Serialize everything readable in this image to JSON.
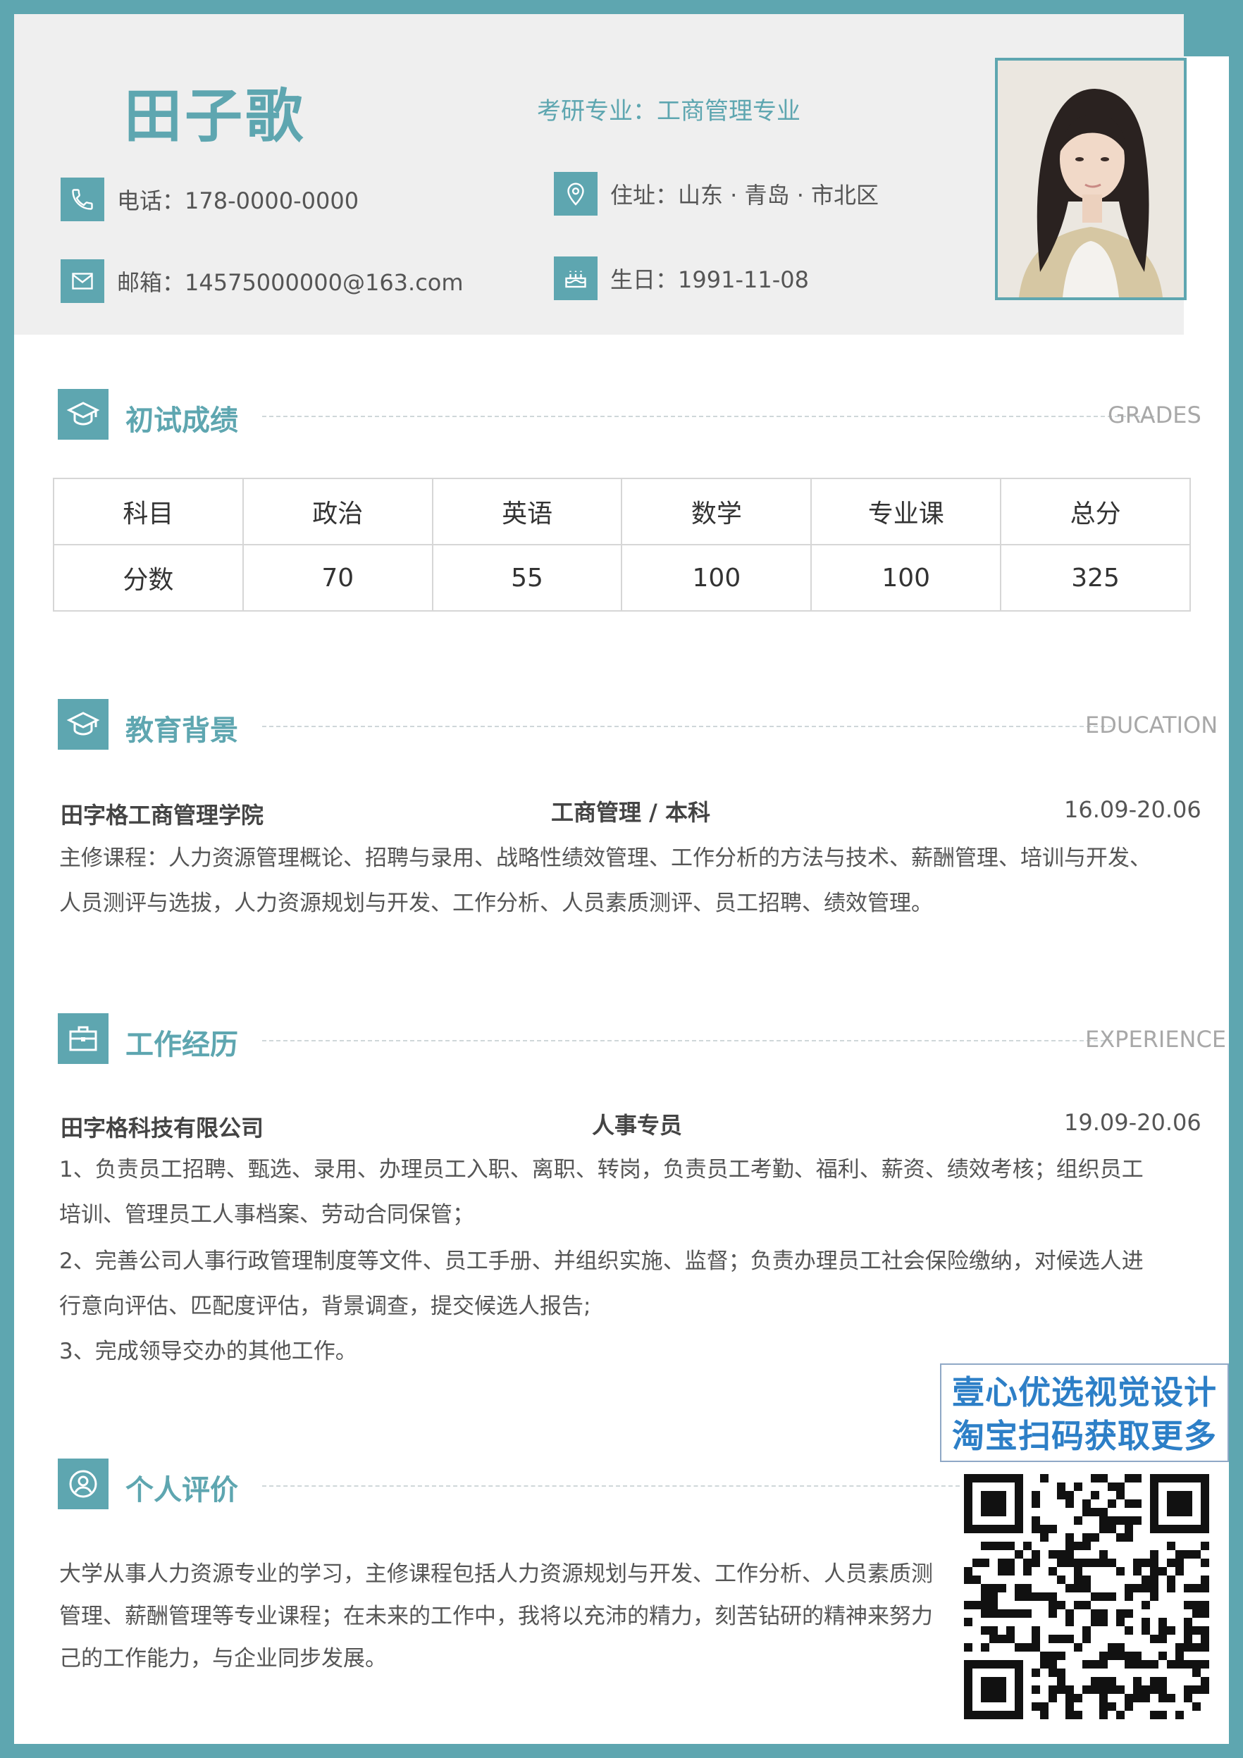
{
  "header": {
    "name": "田子歌",
    "target": "考研专业：工商管理专业",
    "phone": "电话：178-0000-0000",
    "address": "住址：山东 · 青岛 · 市北区",
    "email": "邮箱：14575000000@163.com",
    "birthday": "生日：1991-11-08"
  },
  "grades": {
    "title": "初试成绩",
    "english": "GRADES",
    "headers": [
      "科目",
      "政治",
      "英语",
      "数学",
      "专业课",
      "总分"
    ],
    "scores": [
      "分数",
      "70",
      "55",
      "100",
      "100",
      "325"
    ]
  },
  "education": {
    "title": "教育背景",
    "english": "EDUCATION",
    "school": "田字格工商管理学院",
    "major": "工商管理 / 本科",
    "period": "16.09-20.06",
    "courses_line1": "主修课程：人力资源管理概论、招聘与录用、战略性绩效管理、工作分析的方法与技术、薪酬管理、培训与开发、",
    "courses_line2": "人员测评与选拔，人力资源规划与开发、工作分析、人员素质测评、员工招聘、绩效管理。"
  },
  "experience": {
    "title": "工作经历",
    "english": "EXPERIENCE",
    "company": "田字格科技有限公司",
    "position": "人事专员",
    "period": "19.09-20.06",
    "line1": "1、负责员工招聘、甄选、录用、办理员工入职、离职、转岗，负责员工考勤、福利、薪资、绩效考核；组织员工",
    "line2": "培训、管理员工人事档案、劳动合同保管；",
    "line3": "2、完善公司人事行政管理制度等文件、员工手册、并组织实施、监督；负责办理员工社会保险缴纳，对候选人进",
    "line4": "行意向评估、匹配度评估，背景调查，提交候选人报告;",
    "line5": "3、完成领导交办的其他工作。"
  },
  "evaluation": {
    "title": "个人评价",
    "line1": "大学从事人力资源专业的学习，主修课程包括人力资源规划与开发、工作分析、人员素质测",
    "line2": "管理、薪酬管理等专业课程；在未来的工作中，我将以充沛的精力，刻苦钻研的精神来努力",
    "line3": "己的工作能力，与企业同步发展。"
  },
  "promo": {
    "line1": "壹心优选视觉设计",
    "line2": "淘宝扫码获取更多"
  },
  "colors": {
    "accent": "#5ea6b0",
    "header_bg": "#efefef",
    "promo_text": "#2d7fc7"
  }
}
